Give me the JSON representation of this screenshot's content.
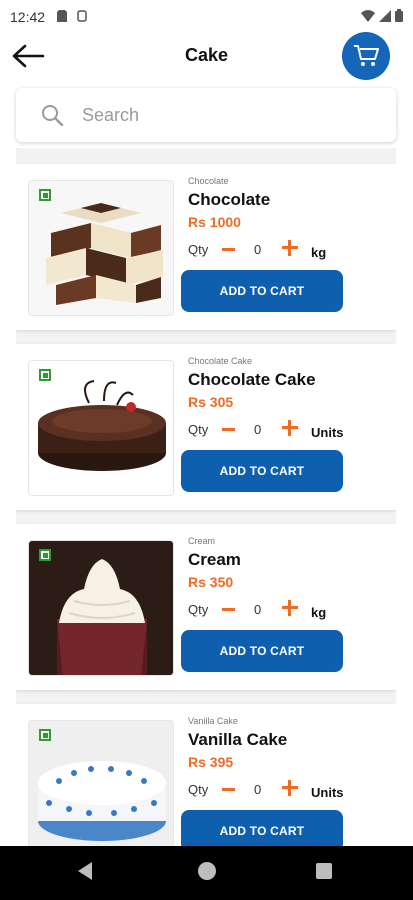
{
  "status_bar": {
    "time": "12:42"
  },
  "app_bar": {
    "title": "Cake"
  },
  "search": {
    "placeholder": "Search"
  },
  "products": [
    {
      "category": "Chocolate",
      "name": "Chocolate",
      "price": "Rs 1000",
      "qty_label": "Qty",
      "qty": "0",
      "unit": "kg",
      "button": "ADD TO CART",
      "image": "chocolate-pieces"
    },
    {
      "category": "Chocolate Cake",
      "name": "Chocolate Cake",
      "price": "Rs 305",
      "qty_label": "Qty",
      "qty": "0",
      "unit": "Units",
      "button": "ADD TO CART",
      "image": "chocolate-cake"
    },
    {
      "category": "Cream",
      "name": "Cream",
      "price": "Rs 350",
      "qty_label": "Qty",
      "qty": "0",
      "unit": "kg",
      "button": "ADD TO CART",
      "image": "cream-dessert"
    },
    {
      "category": "Vanilla Cake",
      "name": "Vanilla Cake",
      "price": "Rs 395",
      "qty_label": "Qty",
      "qty": "0",
      "unit": "Units",
      "button": "ADD TO CART",
      "image": "vanilla-cake"
    }
  ],
  "colors": {
    "primary": "#0e5fae",
    "accent": "#ef6a24",
    "veg": "#2e9b2e"
  }
}
